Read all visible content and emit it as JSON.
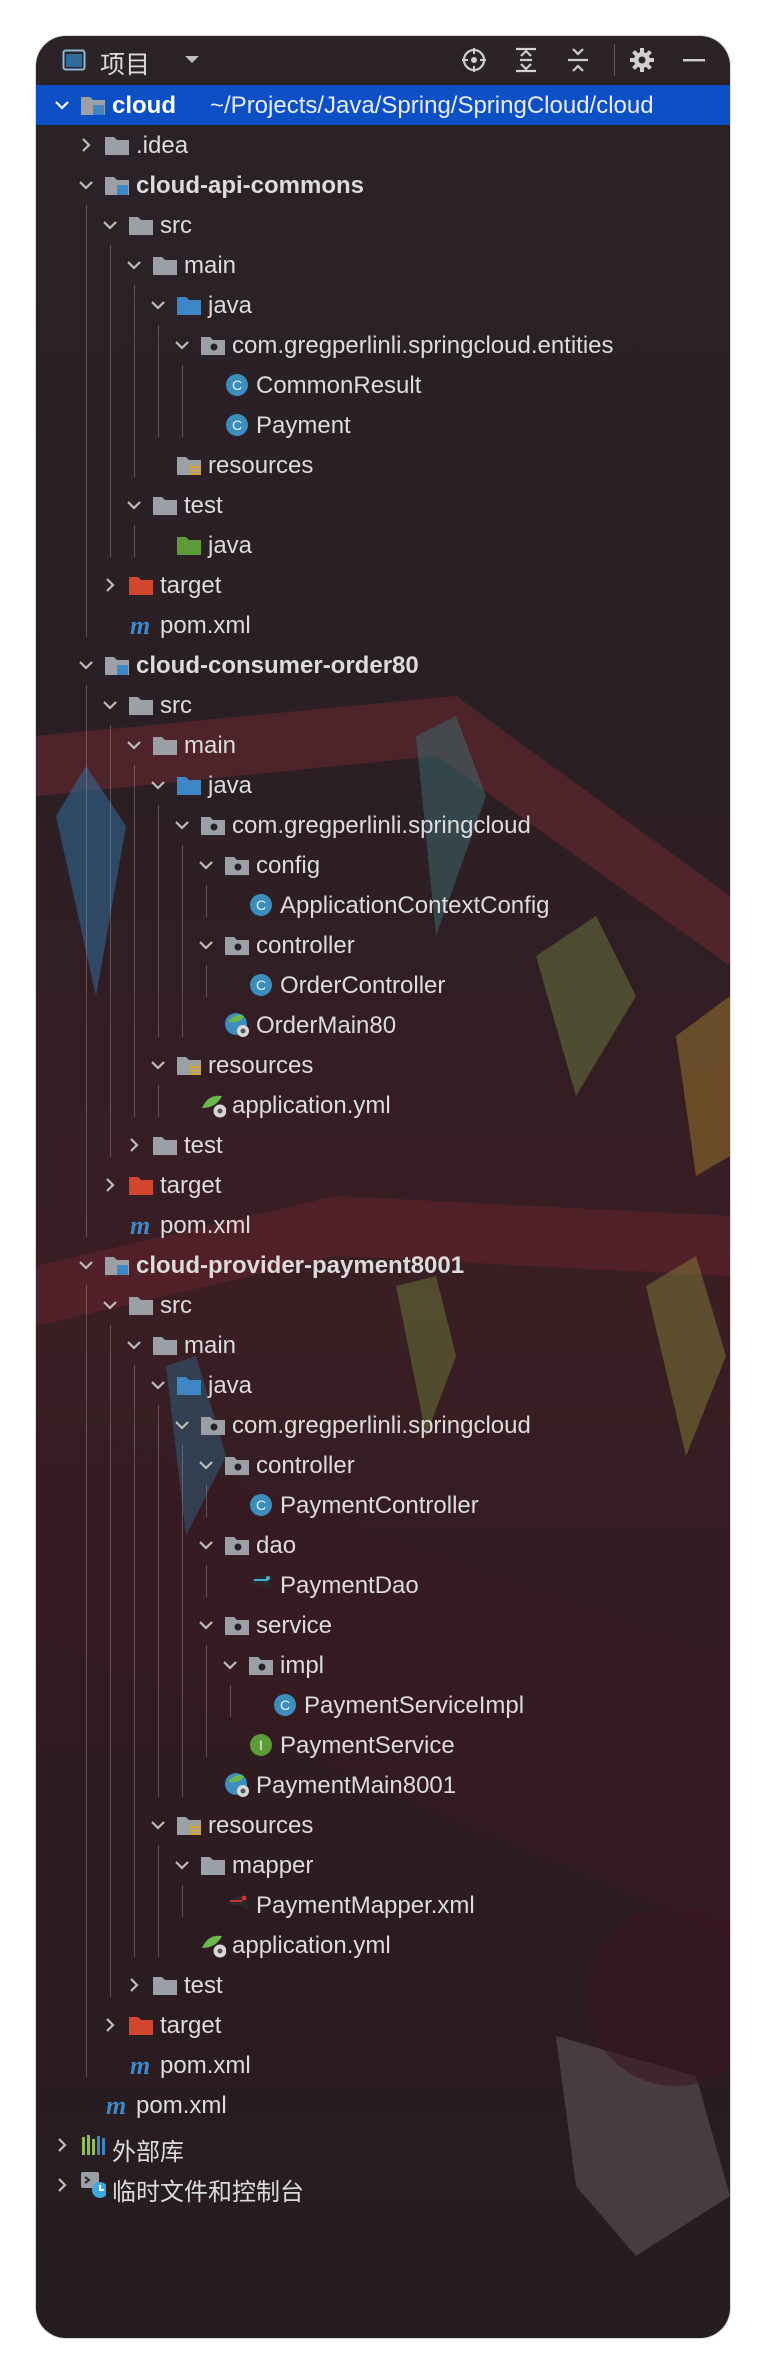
{
  "toolbar": {
    "title": "项目",
    "icons": [
      "project-view-icon",
      "dropdown-icon",
      "locate-icon",
      "expand-all-icon",
      "collapse-all-icon",
      "settings-icon",
      "hide-icon"
    ]
  },
  "tree": [
    {
      "label": "cloud",
      "path": "~/Projects/Java/Spring/SpringCloud/cloud",
      "level": 0,
      "icon": "module-folder",
      "expand": "open",
      "bold": true,
      "selected": true
    },
    {
      "label": ".idea",
      "level": 1,
      "icon": "folder",
      "expand": "closed"
    },
    {
      "label": "cloud-api-commons",
      "level": 1,
      "icon": "module-folder",
      "expand": "open",
      "bold": true
    },
    {
      "label": "src",
      "level": 2,
      "icon": "folder",
      "expand": "open"
    },
    {
      "label": "main",
      "level": 3,
      "icon": "folder",
      "expand": "open"
    },
    {
      "label": "java",
      "level": 4,
      "icon": "source-folder",
      "expand": "open"
    },
    {
      "label": "com.gregperlinli.springcloud.entities",
      "level": 5,
      "icon": "package",
      "expand": "open"
    },
    {
      "label": "CommonResult",
      "level": 6,
      "icon": "class",
      "expand": "none"
    },
    {
      "label": "Payment",
      "level": 6,
      "icon": "class",
      "expand": "none"
    },
    {
      "label": "resources",
      "level": 4,
      "icon": "resources-folder",
      "expand": "none"
    },
    {
      "label": "test",
      "level": 3,
      "icon": "folder",
      "expand": "open"
    },
    {
      "label": "java",
      "level": 4,
      "icon": "test-folder",
      "expand": "none"
    },
    {
      "label": "target",
      "level": 2,
      "icon": "excluded-folder",
      "expand": "closed"
    },
    {
      "label": "pom.xml",
      "level": 2,
      "icon": "maven",
      "expand": "none"
    },
    {
      "label": "cloud-consumer-order80",
      "level": 1,
      "icon": "module-folder",
      "expand": "open",
      "bold": true
    },
    {
      "label": "src",
      "level": 2,
      "icon": "folder",
      "expand": "open"
    },
    {
      "label": "main",
      "level": 3,
      "icon": "folder",
      "expand": "open"
    },
    {
      "label": "java",
      "level": 4,
      "icon": "source-folder",
      "expand": "open"
    },
    {
      "label": "com.gregperlinli.springcloud",
      "level": 5,
      "icon": "package",
      "expand": "open"
    },
    {
      "label": "config",
      "level": 6,
      "icon": "package",
      "expand": "open"
    },
    {
      "label": "ApplicationContextConfig",
      "level": 7,
      "icon": "class",
      "expand": "none"
    },
    {
      "label": "controller",
      "level": 6,
      "icon": "package",
      "expand": "open"
    },
    {
      "label": "OrderController",
      "level": 7,
      "icon": "class",
      "expand": "none"
    },
    {
      "label": "OrderMain80",
      "level": 6,
      "icon": "spring-class",
      "expand": "none"
    },
    {
      "label": "resources",
      "level": 4,
      "icon": "resources-folder",
      "expand": "open"
    },
    {
      "label": "application.yml",
      "level": 5,
      "icon": "spring-yml",
      "expand": "none"
    },
    {
      "label": "test",
      "level": 3,
      "icon": "folder",
      "expand": "closed"
    },
    {
      "label": "target",
      "level": 2,
      "icon": "excluded-folder",
      "expand": "closed"
    },
    {
      "label": "pom.xml",
      "level": 2,
      "icon": "maven",
      "expand": "none"
    },
    {
      "label": "cloud-provider-payment8001",
      "level": 1,
      "icon": "module-folder",
      "expand": "open",
      "bold": true
    },
    {
      "label": "src",
      "level": 2,
      "icon": "folder",
      "expand": "open"
    },
    {
      "label": "main",
      "level": 3,
      "icon": "folder",
      "expand": "open"
    },
    {
      "label": "java",
      "level": 4,
      "icon": "source-folder",
      "expand": "open"
    },
    {
      "label": "com.gregperlinli.springcloud",
      "level": 5,
      "icon": "package",
      "expand": "open"
    },
    {
      "label": "controller",
      "level": 6,
      "icon": "package",
      "expand": "open"
    },
    {
      "label": "PaymentController",
      "level": 7,
      "icon": "class",
      "expand": "none"
    },
    {
      "label": "dao",
      "level": 6,
      "icon": "package",
      "expand": "open"
    },
    {
      "label": "PaymentDao",
      "level": 7,
      "icon": "mybatis-interface",
      "expand": "none"
    },
    {
      "label": "service",
      "level": 6,
      "icon": "package",
      "expand": "open"
    },
    {
      "label": "impl",
      "level": 7,
      "icon": "package",
      "expand": "open"
    },
    {
      "label": "PaymentServiceImpl",
      "level": 8,
      "icon": "class",
      "expand": "none"
    },
    {
      "label": "PaymentService",
      "level": 7,
      "icon": "interface",
      "expand": "none"
    },
    {
      "label": "PaymentMain8001",
      "level": 6,
      "icon": "spring-class",
      "expand": "none"
    },
    {
      "label": "resources",
      "level": 4,
      "icon": "resources-folder",
      "expand": "open"
    },
    {
      "label": "mapper",
      "level": 5,
      "icon": "folder",
      "expand": "open"
    },
    {
      "label": "PaymentMapper.xml",
      "level": 6,
      "icon": "mybatis-xml",
      "expand": "none"
    },
    {
      "label": "application.yml",
      "level": 5,
      "icon": "spring-yml",
      "expand": "none"
    },
    {
      "label": "test",
      "level": 3,
      "icon": "folder",
      "expand": "closed"
    },
    {
      "label": "target",
      "level": 2,
      "icon": "excluded-folder",
      "expand": "closed"
    },
    {
      "label": "pom.xml",
      "level": 2,
      "icon": "maven",
      "expand": "none"
    },
    {
      "label": "pom.xml",
      "level": 1,
      "icon": "maven",
      "expand": "none"
    },
    {
      "label": "外部库",
      "level": 0,
      "icon": "libraries",
      "expand": "closed"
    },
    {
      "label": "临时文件和控制台",
      "level": 0,
      "icon": "scratches",
      "expand": "closed"
    }
  ],
  "colors": {
    "selection": "#0d4fc4",
    "folder": "#9aa0a6",
    "source_folder": "#3e86c6",
    "test_folder": "#5c9a3a",
    "excluded_folder": "#d2452e",
    "class_icon": "#3c8fbd",
    "interface_icon": "#5c9a3a",
    "maven_icon": "#3e86c6"
  }
}
